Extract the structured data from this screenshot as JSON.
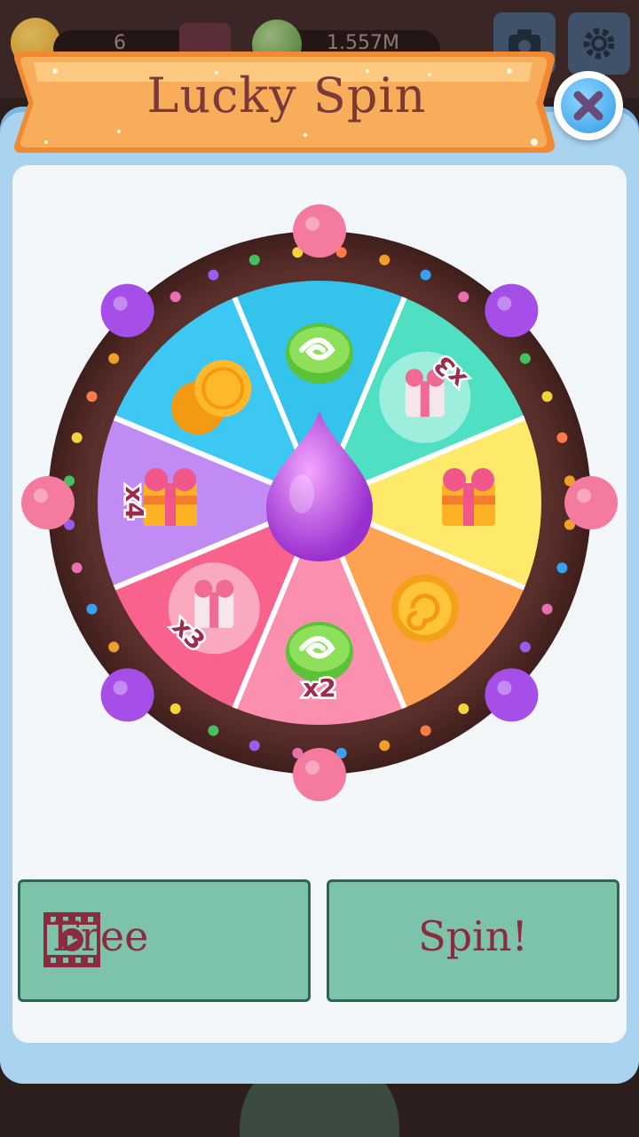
{
  "background_hud": {
    "coins_value": "6",
    "candy_value": "1.557M"
  },
  "dialog": {
    "title": "Lucky Spin"
  },
  "wheel": {
    "segments": [
      {
        "reward": "green swirl candy",
        "multiplier": "",
        "color": "#34c3ea"
      },
      {
        "reward": "gift bubble",
        "multiplier": "x3",
        "color": "#4fe0c4"
      },
      {
        "reward": "gift box",
        "multiplier": "",
        "color": "#fde96a"
      },
      {
        "reward": "orange swirl candy",
        "multiplier": "",
        "color": "#fda153"
      },
      {
        "reward": "green swirl candy",
        "multiplier": "x2",
        "color": "#fb8fb0"
      },
      {
        "reward": "gift bubble",
        "multiplier": "x3",
        "color": "#f9628c"
      },
      {
        "reward": "gift box",
        "multiplier": "x4",
        "color": "#c08bf2"
      },
      {
        "reward": "gold coins",
        "multiplier": "",
        "color": "#3dc8f3"
      }
    ]
  },
  "buttons": {
    "free_label": "Free",
    "spin_label": "Spin!"
  },
  "colors": {
    "button_fill": "#7dc2ab",
    "button_text": "#8a2c3e",
    "banner": "#f69a4a",
    "modal": "#a9d3ef"
  }
}
